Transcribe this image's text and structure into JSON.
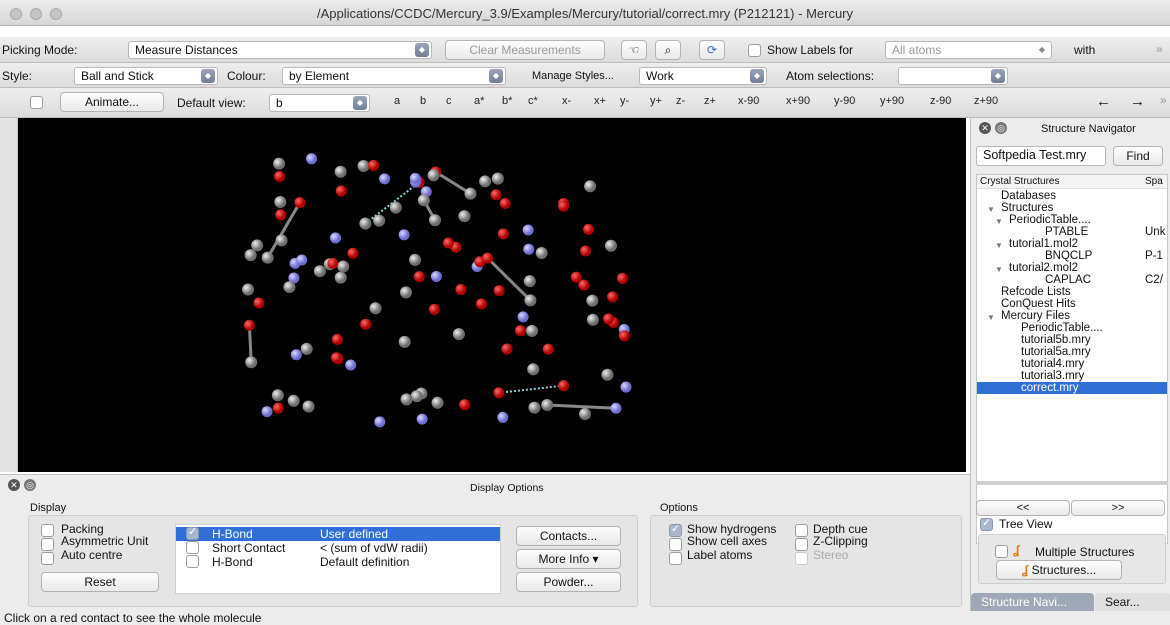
{
  "window": {
    "title": "/Applications/CCDC/Mercury_3.9/Examples/Mercury/tutorial/correct.mry (P212121) - Mercury"
  },
  "toolbar1": {
    "picking_mode_label": "Picking Mode:",
    "picking_mode_value": "Measure Distances",
    "clear_measurements": "Clear Measurements",
    "show_labels_label": "Show Labels for",
    "show_labels_value": "All atoms",
    "with_label": "with",
    "overflow": "»"
  },
  "toolbar2": {
    "style_label": "Style:",
    "style_value": "Ball and Stick",
    "colour_label": "Colour:",
    "colour_value": "by Element",
    "manage_styles": "Manage Styles...",
    "work_value": "Work",
    "atom_selections_label": "Atom selections:",
    "atom_selections_value": ""
  },
  "toolbar3": {
    "animate": "Animate...",
    "default_view_label": "Default view:",
    "default_view_value": "b",
    "view_buttons": [
      "a",
      "b",
      "c",
      "a*",
      "b*",
      "c*",
      "x-",
      "x+",
      "y-",
      "y+",
      "z-",
      "z+",
      "x-90",
      "x+90",
      "y-90",
      "y+90",
      "z-90",
      "z+90"
    ],
    "back_arrow": "←",
    "forward_arrow": "→",
    "overflow": "»"
  },
  "navigator": {
    "title": "Structure Navigator",
    "search_value": "Softpedia Test.mry",
    "find": "Find",
    "col_structures": "Crystal Structures",
    "col_space": "Spa",
    "tree": [
      {
        "label": "Databases",
        "extra": ""
      },
      {
        "label": "Structures",
        "extra": ""
      },
      {
        "label": "PeriodicTable....",
        "extra": ""
      },
      {
        "label": "PTABLE",
        "extra": "Unk"
      },
      {
        "label": "tutorial1.mol2",
        "extra": ""
      },
      {
        "label": "BNQCLP",
        "extra": "P-1"
      },
      {
        "label": "tutorial2.mol2",
        "extra": ""
      },
      {
        "label": "CAPLAC",
        "extra": "C2/"
      },
      {
        "label": "Refcode Lists",
        "extra": ""
      },
      {
        "label": "ConQuest Hits",
        "extra": ""
      },
      {
        "label": "Mercury Files",
        "extra": ""
      },
      {
        "label": "PeriodicTable....",
        "extra": ""
      },
      {
        "label": "tutorial5b.mry",
        "extra": ""
      },
      {
        "label": "tutorial5a.mry",
        "extra": ""
      },
      {
        "label": "tutorial4.mry",
        "extra": ""
      },
      {
        "label": "tutorial3.mry",
        "extra": ""
      },
      {
        "label": "correct.mry",
        "extra": ""
      }
    ],
    "prev": "<<",
    "next": ">>",
    "tree_view": "Tree View",
    "multiple_structures": "Multiple Structures",
    "structures_btn": "Structures...",
    "tab_navigator": "Structure Navi...",
    "tab_search": "Sear..."
  },
  "display_options": {
    "title": "Display Options",
    "display_group": "Display",
    "packing": "Packing",
    "asymmetric_unit": "Asymmetric Unit",
    "auto_centre": "Auto centre",
    "reset": "Reset",
    "contacts_rows": [
      {
        "type": "H-Bond",
        "desc": "User defined",
        "checked": true
      },
      {
        "type": "Short Contact",
        "desc": "< (sum of vdW radii)",
        "checked": false
      },
      {
        "type": "H-Bond",
        "desc": "Default definition",
        "checked": false
      }
    ],
    "contacts_btn": "Contacts...",
    "more_info_btn": "More Info ▾",
    "powder_btn": "Powder...",
    "options_group": "Options",
    "show_hydrogens": "Show hydrogens",
    "show_cell_axes": "Show cell axes",
    "label_atoms": "Label atoms",
    "depth_cue": "Depth cue",
    "z_clipping": "Z-Clipping",
    "stereo": "Stereo"
  },
  "status": {
    "text": "Click on a red contact to see the whole molecule"
  },
  "colors": {
    "selection": "#2f6fd6",
    "oxygen": "#e00000",
    "carbon": "#a8a8a8",
    "nitrogen": "#9c9ce8",
    "hbond": "#7fd4d4"
  }
}
